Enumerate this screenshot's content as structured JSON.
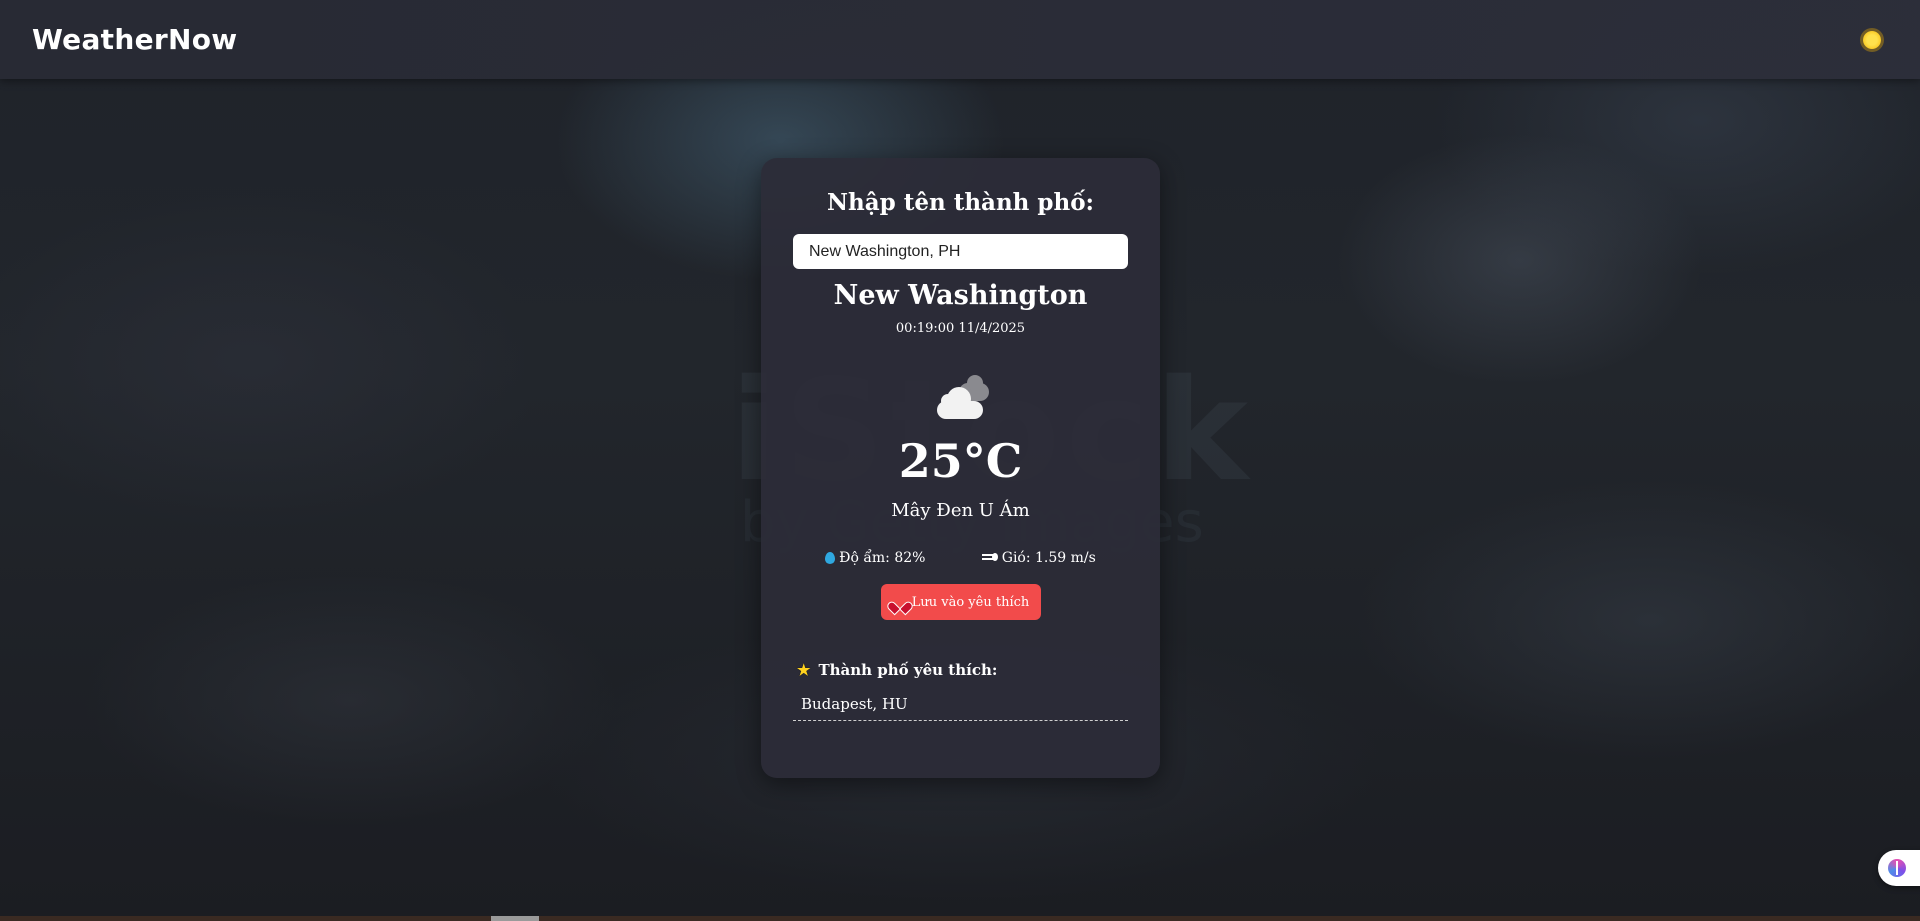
{
  "header": {
    "logo": "WeatherNow",
    "theme_toggle_icon": "sun-icon"
  },
  "search": {
    "title": "Nhập tên thành phố:",
    "value": "New Washington, PH"
  },
  "weather": {
    "city": "New Washington",
    "datetime": "00:19:00 11/4/2025",
    "icon": "cloud-icon",
    "temperature": "25°C",
    "description": "Mây Đen U Ám",
    "humidity": "Độ ẩm: 82%",
    "wind": "Gió: 1.59 m/s"
  },
  "actions": {
    "save_label": "Lưu vào yêu thích"
  },
  "favorites": {
    "title": "Thành phố yêu thích:",
    "items": [
      "Budapest, HU"
    ]
  },
  "colors": {
    "accent": "#f24b4b",
    "card_bg": "#2c2c38",
    "header_bg": "#2a2c36",
    "humidity_icon": "#2fa8e0",
    "star": "#ffd21f"
  }
}
